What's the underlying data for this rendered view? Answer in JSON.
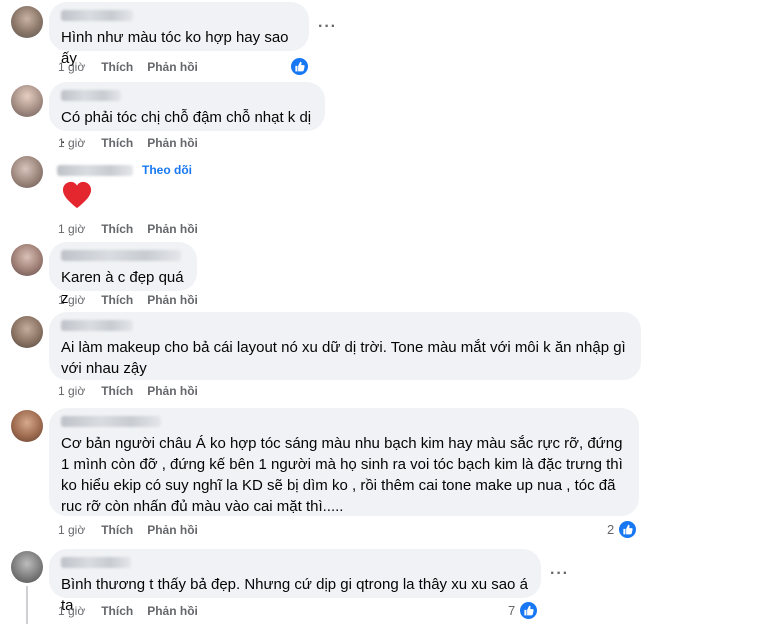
{
  "common": {
    "time": "1 giờ",
    "like": "Thích",
    "reply": "Phản hồi",
    "more": "···",
    "follow": "Theo dõi"
  },
  "comments": [
    {
      "text": "Hình như màu tóc ko hợp hay sao ấy",
      "reactions": ""
    },
    {
      "text": "Có phải tóc chị chỗ đậm chỗ nhạt k dị .",
      "reactions": ""
    },
    {
      "text": "",
      "emoji": "❤",
      "reactions": ""
    },
    {
      "text": "Karen à c đẹp quá z",
      "reactions": ""
    },
    {
      "text": "Ai làm makeup cho bả cái layout nó xu dữ dị trời. Tone màu mắt với môi k ăn nhập gì với nhau zậy",
      "reactions": ""
    },
    {
      "text": "Cơ bản người châu Á ko hợp tóc sáng màu nhu bạch kim hay màu sắc rực rỡ, đứng 1 mình còn đỡ , đứng kế bên 1 người mà họ sinh ra voi tóc bạch kim là đặc trưng thì ko hiểu ekip có suy nghĩ la KD sẽ bị dìm ko , rồi thêm cai tone make up nua , tóc đã ruc rỡ còn nhấn đủ màu vào cai mặt thì.....",
      "reactions": "2"
    },
    {
      "text": "Bình thương t thấy bả đẹp. Nhưng cứ dịp gi qtrong la thây xu xu sao á ta",
      "reactions": "7"
    }
  ],
  "colors": {
    "bubble": "#f0f2f5",
    "accent": "#1877f2",
    "secondary_text": "#65676b",
    "heart": "#e4272f"
  }
}
